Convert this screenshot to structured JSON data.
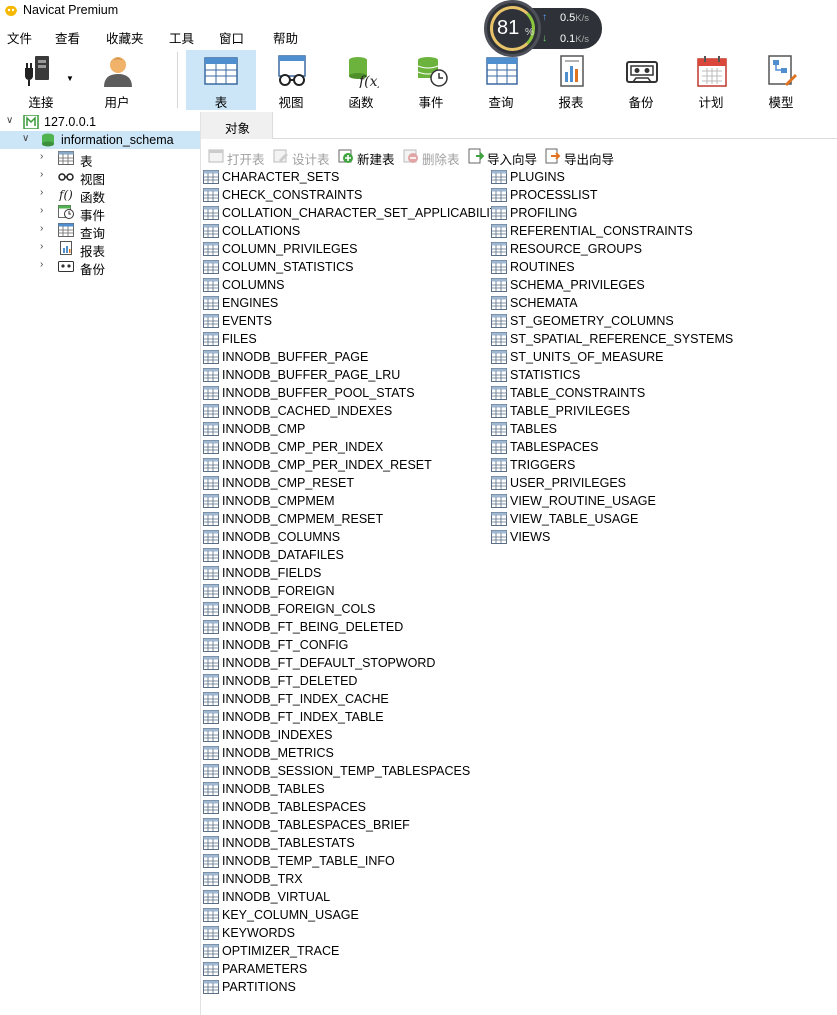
{
  "window": {
    "title": "Navicat Premium"
  },
  "menu": [
    "文件",
    "查看",
    "收藏夹",
    "工具",
    "窗口",
    "帮助"
  ],
  "toolbar": [
    {
      "label": "连接",
      "icon": "plug-icon"
    },
    {
      "label": "用户",
      "icon": "user-icon"
    },
    {
      "label": "表",
      "icon": "table-icon"
    },
    {
      "label": "视图",
      "icon": "view-glasses-icon"
    },
    {
      "label": "函数",
      "icon": "function-icon"
    },
    {
      "label": "事件",
      "icon": "event-icon"
    },
    {
      "label": "查询",
      "icon": "query-icon"
    },
    {
      "label": "报表",
      "icon": "report-icon"
    },
    {
      "label": "备份",
      "icon": "backup-icon"
    },
    {
      "label": "计划",
      "icon": "schedule-icon"
    },
    {
      "label": "模型",
      "icon": "model-icon"
    }
  ],
  "perf": {
    "cpu": "81",
    "pct": "%",
    "up": "0.5",
    "up_unit": "K/s",
    "down": "0.1",
    "down_unit": "K/s"
  },
  "tree": {
    "connection": "127.0.0.1",
    "database": "information_schema",
    "children": [
      {
        "label": "表",
        "icon": "table-icon"
      },
      {
        "label": "视图",
        "icon": "view-glasses-icon"
      },
      {
        "label": "函数",
        "icon": "function-icon"
      },
      {
        "label": "事件",
        "icon": "event-icon"
      },
      {
        "label": "查询",
        "icon": "query-icon"
      },
      {
        "label": "报表",
        "icon": "report-icon"
      },
      {
        "label": "备份",
        "icon": "backup-icon"
      }
    ]
  },
  "tabs": [
    {
      "label": "对象"
    }
  ],
  "object_toolbar": [
    {
      "label": "打开表",
      "icon": "open-table-icon",
      "enabled": false
    },
    {
      "label": "设计表",
      "icon": "design-table-icon",
      "enabled": false
    },
    {
      "label": "新建表",
      "icon": "new-table-icon",
      "enabled": true
    },
    {
      "label": "删除表",
      "icon": "delete-table-icon",
      "enabled": false
    },
    {
      "label": "导入向导",
      "icon": "import-wizard-icon",
      "enabled": true
    },
    {
      "label": "导出向导",
      "icon": "export-wizard-icon",
      "enabled": true
    }
  ],
  "tables_col1": [
    "CHARACTER_SETS",
    "CHECK_CONSTRAINTS",
    "COLLATION_CHARACTER_SET_APPLICABILITY",
    "COLLATIONS",
    "COLUMN_PRIVILEGES",
    "COLUMN_STATISTICS",
    "COLUMNS",
    "ENGINES",
    "EVENTS",
    "FILES",
    "INNODB_BUFFER_PAGE",
    "INNODB_BUFFER_PAGE_LRU",
    "INNODB_BUFFER_POOL_STATS",
    "INNODB_CACHED_INDEXES",
    "INNODB_CMP",
    "INNODB_CMP_PER_INDEX",
    "INNODB_CMP_PER_INDEX_RESET",
    "INNODB_CMP_RESET",
    "INNODB_CMPMEM",
    "INNODB_CMPMEM_RESET",
    "INNODB_COLUMNS",
    "INNODB_DATAFILES",
    "INNODB_FIELDS",
    "INNODB_FOREIGN",
    "INNODB_FOREIGN_COLS",
    "INNODB_FT_BEING_DELETED",
    "INNODB_FT_CONFIG",
    "INNODB_FT_DEFAULT_STOPWORD",
    "INNODB_FT_DELETED",
    "INNODB_FT_INDEX_CACHE",
    "INNODB_FT_INDEX_TABLE",
    "INNODB_INDEXES",
    "INNODB_METRICS",
    "INNODB_SESSION_TEMP_TABLESPACES",
    "INNODB_TABLES",
    "INNODB_TABLESPACES",
    "INNODB_TABLESPACES_BRIEF",
    "INNODB_TABLESTATS",
    "INNODB_TEMP_TABLE_INFO",
    "INNODB_TRX",
    "INNODB_VIRTUAL",
    "KEY_COLUMN_USAGE",
    "KEYWORDS",
    "OPTIMIZER_TRACE",
    "PARAMETERS",
    "PARTITIONS"
  ],
  "tables_col2": [
    "PLUGINS",
    "PROCESSLIST",
    "PROFILING",
    "REFERENTIAL_CONSTRAINTS",
    "RESOURCE_GROUPS",
    "ROUTINES",
    "SCHEMA_PRIVILEGES",
    "SCHEMATA",
    "ST_GEOMETRY_COLUMNS",
    "ST_SPATIAL_REFERENCE_SYSTEMS",
    "ST_UNITS_OF_MEASURE",
    "STATISTICS",
    "TABLE_CONSTRAINTS",
    "TABLE_PRIVILEGES",
    "TABLES",
    "TABLESPACES",
    "TRIGGERS",
    "USER_PRIVILEGES",
    "VIEW_ROUTINE_USAGE",
    "VIEW_TABLE_USAGE",
    "VIEWS"
  ]
}
